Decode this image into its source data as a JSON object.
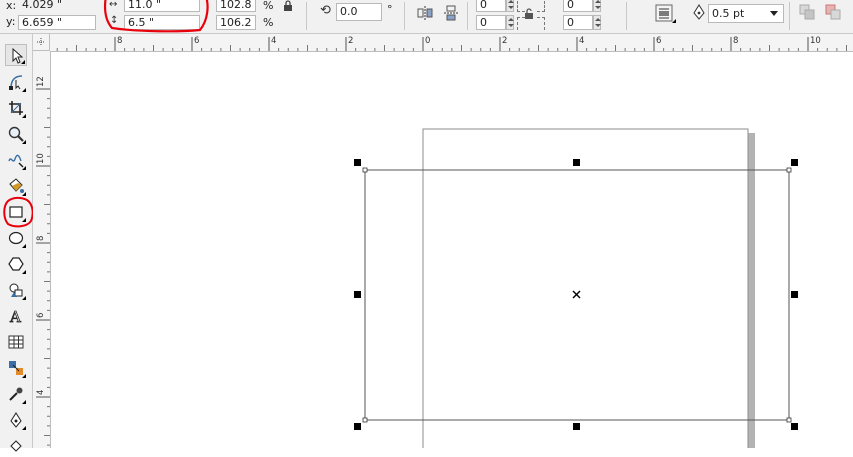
{
  "propbar": {
    "x_label": "x:",
    "x_value": "4.029 \"",
    "y_label": "y:",
    "y_value": "6.659 \"",
    "width_value": "11.0 \"",
    "height_value": "6.5 \"",
    "scale_x": "102.8",
    "scale_y": "106.2",
    "percent_symbol": "%",
    "rotation_value": "0.0",
    "degree_symbol": "°",
    "corner_tl": "0",
    "corner_bl": "0",
    "corner_tr": "0",
    "corner_br": "0",
    "outline_width": "0.5 pt",
    "annotation_color": "#e8000b"
  },
  "ruler_top": {
    "labels": [
      "8",
      "6",
      "4",
      "2",
      "0",
      "2",
      "4",
      "6",
      "8",
      "10"
    ]
  },
  "ruler_left": {
    "labels": [
      "12",
      "10",
      "8",
      "6",
      "4"
    ]
  },
  "toolbox": {
    "tools": [
      {
        "name": "pick-tool",
        "icon": "arrow-pointer-icon"
      },
      {
        "name": "shape-tool",
        "icon": "shape-node-icon"
      },
      {
        "name": "crop-tool",
        "icon": "crop-icon"
      },
      {
        "name": "zoom-tool",
        "icon": "magnifier-icon"
      },
      {
        "name": "freehand-tool",
        "icon": "freehand-curve-icon"
      },
      {
        "name": "smart-fill-tool",
        "icon": "smart-fill-icon"
      },
      {
        "name": "rectangle-tool",
        "icon": "rectangle-icon"
      },
      {
        "name": "ellipse-tool",
        "icon": "ellipse-icon"
      },
      {
        "name": "polygon-tool",
        "icon": "polygon-icon"
      },
      {
        "name": "basic-shapes-tool",
        "icon": "basic-shapes-icon"
      },
      {
        "name": "text-tool",
        "icon": "text-a-icon"
      },
      {
        "name": "table-tool",
        "icon": "table-grid-icon"
      },
      {
        "name": "interactive-blend-tool",
        "icon": "blend-icon"
      },
      {
        "name": "eyedropper-tool",
        "icon": "eyedropper-icon"
      },
      {
        "name": "outline-pen-tool",
        "icon": "pen-nib-icon"
      }
    ]
  }
}
